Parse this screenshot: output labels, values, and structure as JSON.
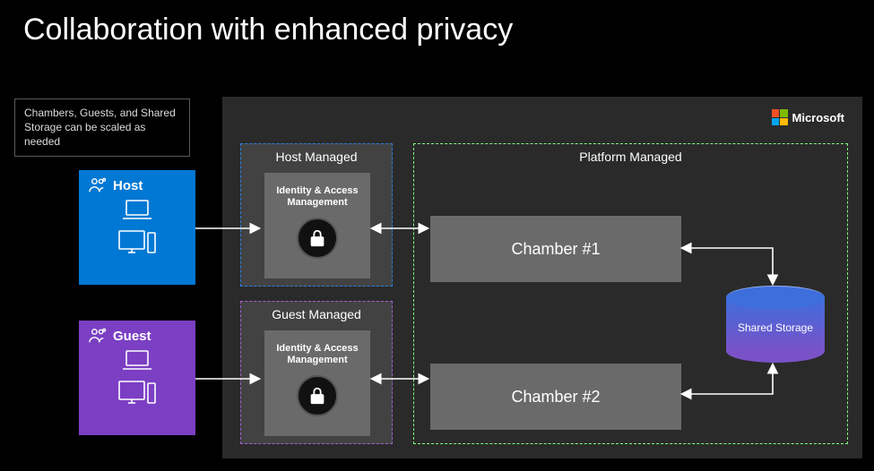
{
  "title": "Collaboration with enhanced privacy",
  "note": "Chambers, Guests, and Shared Storage can be scaled as needed",
  "brand": "Microsoft",
  "roles": {
    "host": {
      "label": "Host"
    },
    "guest": {
      "label": "Guest"
    }
  },
  "managed": {
    "host": {
      "label": "Host Managed",
      "iam": "Identity & Access Management"
    },
    "guest": {
      "label": "Guest Managed",
      "iam": "Identity & Access Management"
    },
    "platform": {
      "label": "Platform Managed"
    }
  },
  "chambers": {
    "c1": "Chamber #1",
    "c2": "Chamber #2"
  },
  "storage": {
    "label": "Shared Storage"
  }
}
